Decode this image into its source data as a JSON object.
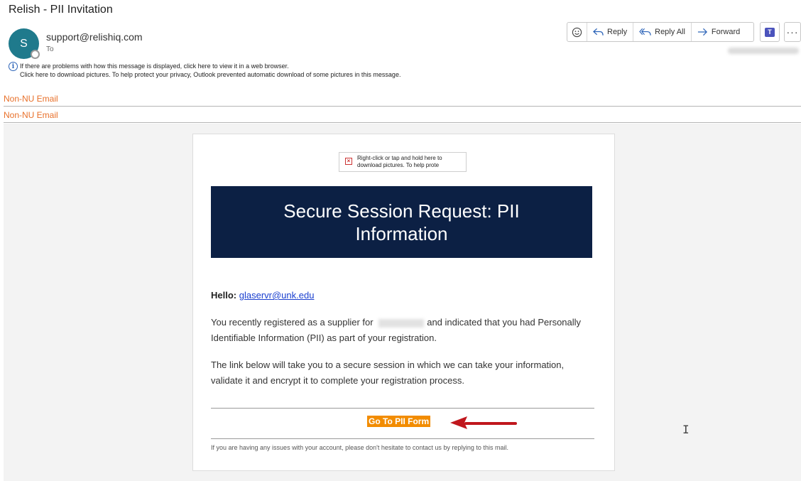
{
  "header": {
    "subject": "Relish - PII Invitation",
    "avatar_initial": "S",
    "sender": "support@relishiq.com",
    "to_label": "To",
    "info_line1": "If there are problems with how this message is displayed, click here to view it in a web browser.",
    "info_line2": "Click here to download pictures. To help protect your privacy, Outlook prevented automatic download of some pictures in this message."
  },
  "toolbar": {
    "reply": "Reply",
    "reply_all": "Reply All",
    "forward": "Forward",
    "more": "···"
  },
  "banners": [
    "Non-NU Email",
    "Non-NU Email"
  ],
  "email": {
    "broken_image_text": "Right-click or tap and hold here to download pictures. To help prote",
    "hero_title": "Secure Session Request: PII Information",
    "hello_label": "Hello:",
    "hello_email": "glaservr@unk.edu",
    "para1_before": "You recently registered as a supplier for",
    "para1_after": "and indicated that you had Personally Identifiable Information (PII) as part of your registration.",
    "para2": "The link below will take you to a secure session in which we can take your information, validate it and encrypt it to complete your registration process.",
    "cta_label": "Go To PII Form",
    "footer": "If you are having any issues with your account, please don't hesitate to contact us by replying to this mail."
  },
  "colors": {
    "hero_bg": "#0c2044",
    "cta_bg": "#f28c00",
    "banner_text": "#e8702a",
    "arrow": "#c0171d",
    "avatar": "#1f7a8c"
  }
}
